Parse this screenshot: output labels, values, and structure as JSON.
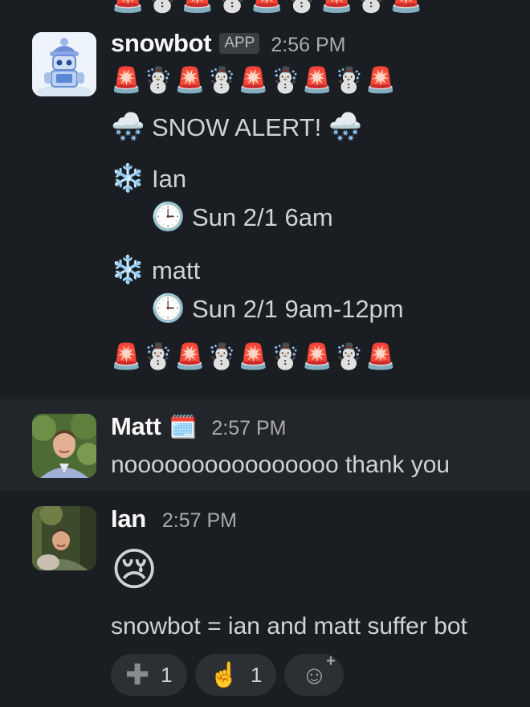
{
  "top_partial_row": "🚨☃️🚨☃️🚨☃️🚨☃️🚨",
  "messages": [
    {
      "sender": "snowbot",
      "badge": "APP",
      "time": "2:56 PM",
      "emoji_row_top": "🚨☃️🚨☃️🚨☃️🚨☃️🚨",
      "alert_icon": "🌨️",
      "alert_text": "SNOW ALERT!",
      "entries": [
        {
          "bullet": "❄️",
          "name": "Ian",
          "clock": "🕒",
          "when": "Sun 2/1 6am"
        },
        {
          "bullet": "❄️",
          "name": "matt",
          "clock": "🕒",
          "when": "Sun 2/1 9am-12pm"
        }
      ],
      "emoji_row_bottom": "🚨☃️🚨☃️🚨☃️🚨☃️🚨"
    },
    {
      "sender": "Matt",
      "status_emoji": "🗓️",
      "time": "2:57 PM",
      "text": "noooooooooooooooo thank you"
    },
    {
      "sender": "Ian",
      "time": "2:57 PM",
      "emoji": "😢",
      "text": "snowbot = ian and matt suffer bot",
      "reactions": [
        {
          "icon": "plus-icon",
          "glyph": "✚",
          "count": "1"
        },
        {
          "icon": "point-up-icon",
          "glyph": "☝️",
          "count": "1"
        }
      ],
      "add_reaction_icon": "add-reaction-icon"
    }
  ]
}
